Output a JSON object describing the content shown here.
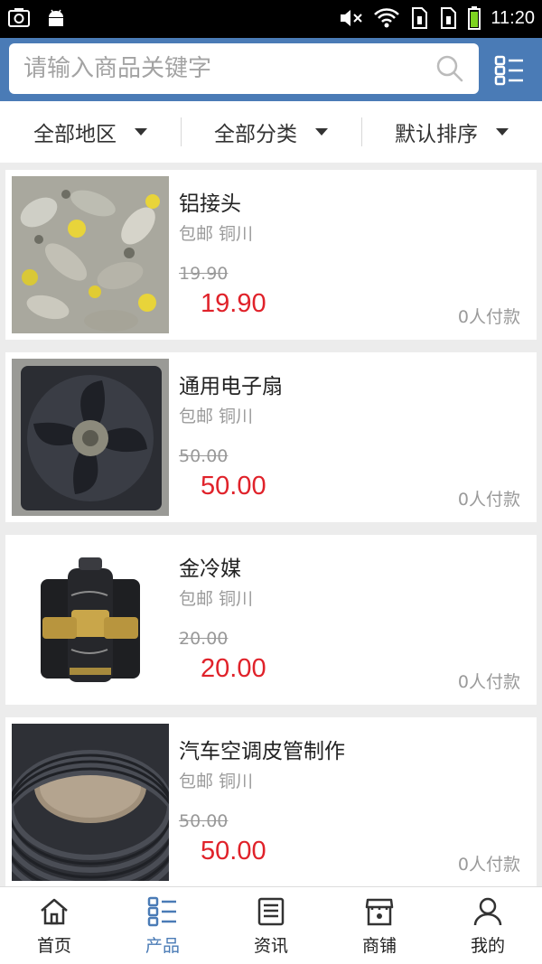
{
  "status_bar": {
    "time": "11:20",
    "icons": [
      "screenshot-icon",
      "android-icon",
      "mute-icon",
      "wifi-icon",
      "sim1-icon",
      "sim2-icon",
      "battery-icon"
    ]
  },
  "search": {
    "placeholder": "请输入商品关键字",
    "value": ""
  },
  "filters": [
    {
      "label": "全部地区"
    },
    {
      "label": "全部分类"
    },
    {
      "label": "默认排序"
    }
  ],
  "products": [
    {
      "name": "铝接头",
      "meta": "包邮 铜川",
      "old_price": "19.90",
      "price": "19.90",
      "sold": "0人付款",
      "image": "aluminum-fittings"
    },
    {
      "name": "通用电子扇",
      "meta": "包邮 铜川",
      "old_price": "50.00",
      "price": "50.00",
      "sold": "0人付款",
      "image": "electronic-fan"
    },
    {
      "name": "金冷媒",
      "meta": "包邮 铜川",
      "old_price": "20.00",
      "price": "20.00",
      "sold": "0人付款",
      "image": "refrigerant-cans"
    },
    {
      "name": "汽车空调皮管制作",
      "meta": "包邮 铜川",
      "old_price": "50.00",
      "price": "50.00",
      "sold": "0人付款",
      "image": "ac-hose-coil"
    }
  ],
  "nav": [
    {
      "label": "首页",
      "icon": "home-icon",
      "active": false
    },
    {
      "label": "产品",
      "icon": "product-grid-icon",
      "active": true
    },
    {
      "label": "资讯",
      "icon": "news-icon",
      "active": false
    },
    {
      "label": "商铺",
      "icon": "shop-icon",
      "active": false
    },
    {
      "label": "我的",
      "icon": "user-icon",
      "active": false
    }
  ],
  "colors": {
    "header": "#4a7bb6",
    "price": "#e0222a",
    "active_nav": "#4a7bb6"
  }
}
